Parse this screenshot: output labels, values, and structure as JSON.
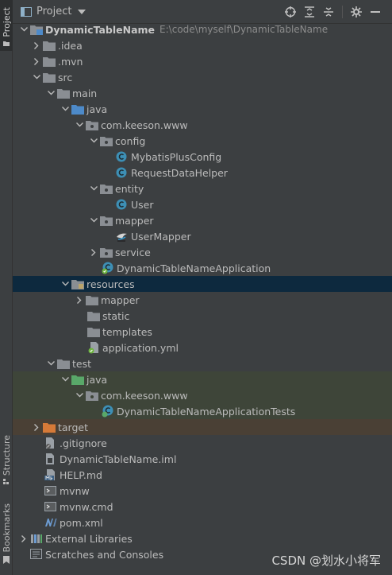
{
  "side_stripe": {
    "project_tab": "Project",
    "structure_tab": "Structure",
    "bookmarks_tab": "Bookmarks"
  },
  "header": {
    "title": "Project"
  },
  "tree": {
    "root": {
      "name": "DynamicTableName",
      "path": "E:\\code\\myself\\DynamicTableName"
    },
    "idea": ".idea",
    "mvn": ".mvn",
    "src": "src",
    "main": "main",
    "main_java": "java",
    "main_pkg": "com.keeson.www",
    "config": "config",
    "mybatis_plus_config": "MybatisPlusConfig",
    "request_data_helper": "RequestDataHelper",
    "entity": "entity",
    "user": "User",
    "mapper": "mapper",
    "user_mapper": "UserMapper",
    "service": "service",
    "application": "DynamicTableNameApplication",
    "resources": "resources",
    "res_mapper": "mapper",
    "static": "static",
    "templates": "templates",
    "application_yml": "application.yml",
    "test": "test",
    "test_java": "java",
    "test_pkg": "com.keeson.www",
    "application_tests": "DynamicTableNameApplicationTests",
    "target": "target",
    "gitignore": ".gitignore",
    "iml": "DynamicTableName.iml",
    "help": "HELP.md",
    "mvnw": "mvnw",
    "mvnw_cmd": "mvnw.cmd",
    "pom": "pom.xml",
    "external_libraries": "External Libraries",
    "scratches": "Scratches and Consoles"
  },
  "watermark": "CSDN @划水小将军",
  "colors": {
    "selection": "#0d293e",
    "test_highlight": "#3e4539",
    "excluded_highlight": "#4a4035",
    "class_icon": "#3d8fb5",
    "folder": "#8a8e93",
    "source_folder": "#4d8ac9",
    "test_folder": "#59a869",
    "target_folder": "#d67a38"
  }
}
